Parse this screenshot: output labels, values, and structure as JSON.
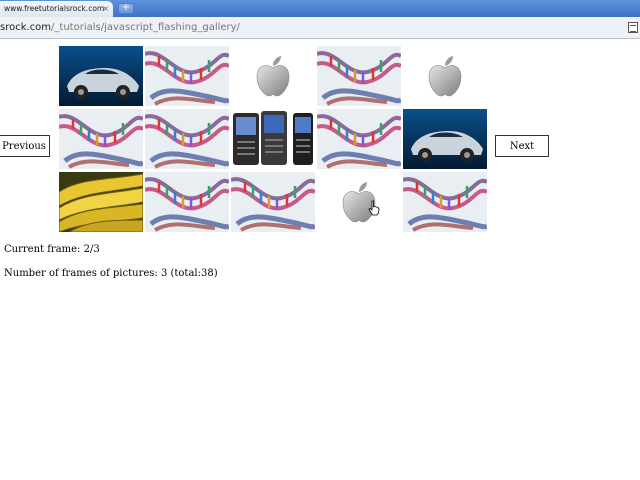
{
  "browser": {
    "tab_title": "www.freetutorialsrock.com",
    "tab_close": "×",
    "new_tab": "+",
    "address_host": "srock.com",
    "address_path": "/_tutorials/javascript_flashing_gallery/"
  },
  "gallery": {
    "prev_label": "Previous",
    "next_label": "Next",
    "rows": [
      [
        "car",
        "dna",
        "apple",
        "dna",
        "apple"
      ],
      [
        "dna",
        "dna",
        "phones",
        "dna",
        "car"
      ],
      [
        "bananas",
        "dna",
        "dna",
        "apple",
        "dna"
      ]
    ]
  },
  "info": {
    "current_frame": "Current frame: 2/3",
    "frames_count": "Number of frames of pictures: 3 (total:38)"
  }
}
